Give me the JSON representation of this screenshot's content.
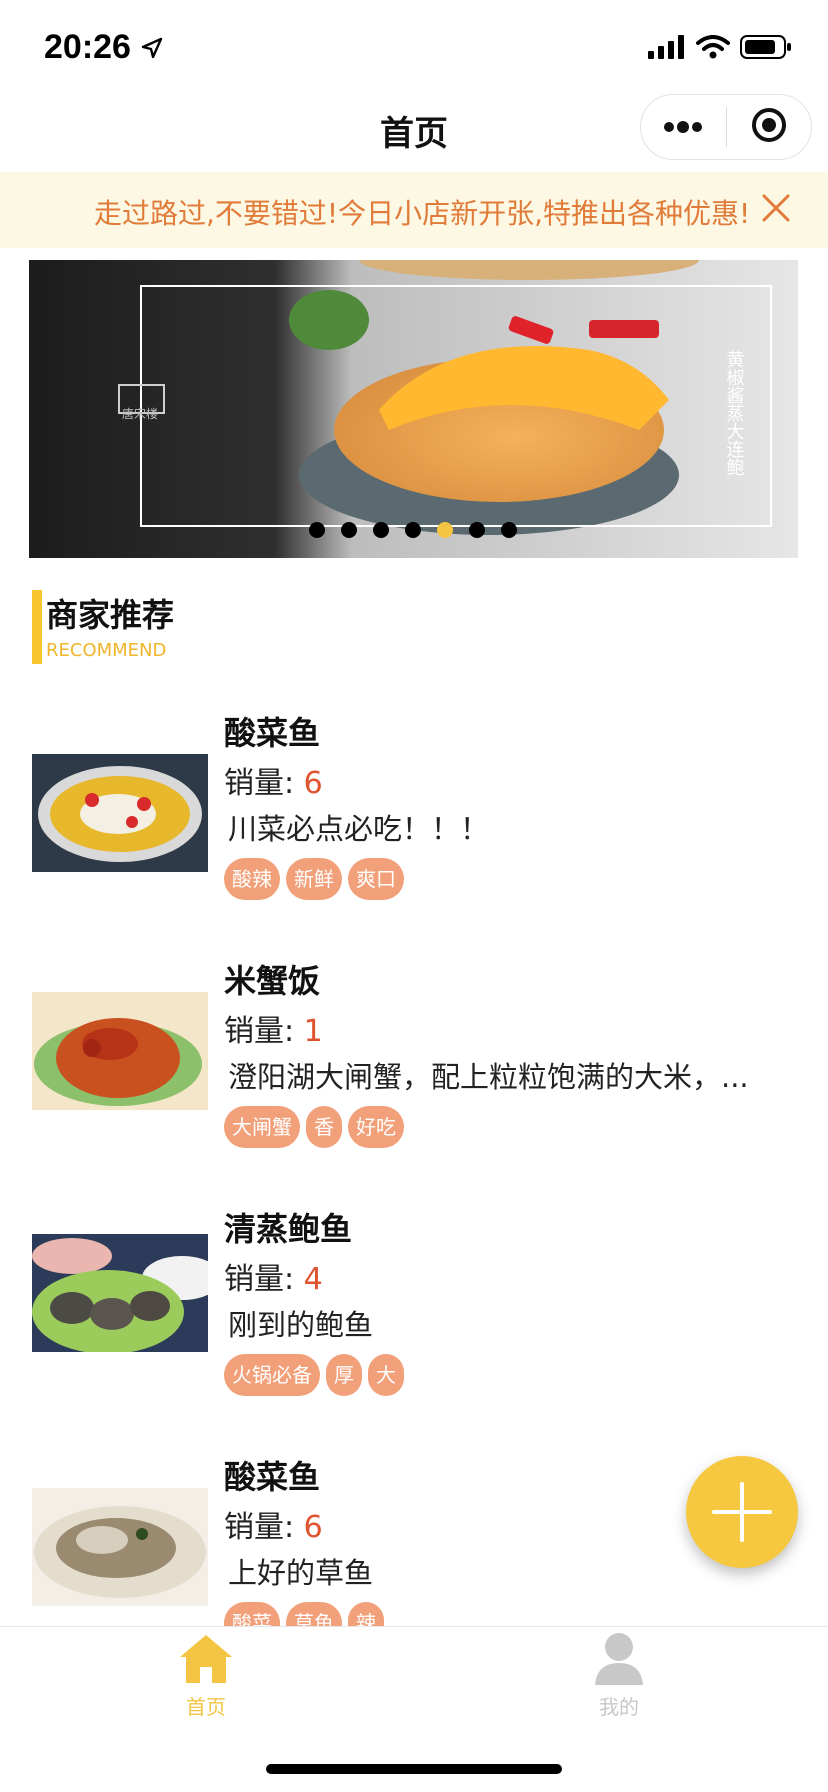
{
  "status_bar": {
    "time": "20:26",
    "icons": [
      "location-arrow-icon",
      "signal-icon",
      "wifi-icon",
      "battery-icon"
    ]
  },
  "nav": {
    "title": "首页",
    "capsule": [
      "more-icon",
      "close-miniprogram-icon"
    ]
  },
  "notice": {
    "text": "走过路过,不要错过!今日小店新开张,特推出各种优惠!",
    "close_icon": "close-icon"
  },
  "banner": {
    "slide_count": 7,
    "active_index": 4,
    "vertical_caption": "黄椒酱蒸大连鲍",
    "logo_caption": "唐宋楼"
  },
  "section": {
    "title": "商家推荐",
    "subtitle": "RECOMMEND"
  },
  "dishes": [
    {
      "name": "酸菜鱼",
      "sales_label": "销量: ",
      "sales": "6",
      "desc": "川菜必点必吃！！！",
      "tags": [
        "酸辣",
        "新鲜",
        "爽口"
      ]
    },
    {
      "name": "米蟹饭",
      "sales_label": "销量: ",
      "sales": "1",
      "desc": "澄阳湖大闸蟹，配上粒粒饱满的大米，...",
      "tags": [
        "大闸蟹",
        "香",
        "好吃"
      ]
    },
    {
      "name": "清蒸鲍鱼",
      "sales_label": "销量: ",
      "sales": "4",
      "desc": "刚到的鲍鱼",
      "tags": [
        "火锅必备",
        "厚",
        "大"
      ]
    },
    {
      "name": "酸菜鱼",
      "sales_label": "销量: ",
      "sales": "6",
      "desc": "上好的草鱼",
      "tags": [
        "酸菜",
        "草鱼",
        "辣"
      ]
    }
  ],
  "fab": {
    "icon": "plus-icon"
  },
  "tab_bar": {
    "items": [
      {
        "label": "首页",
        "icon": "home-icon",
        "active": true
      },
      {
        "label": "我的",
        "icon": "user-icon",
        "active": false
      }
    ],
    "active_color": "#f3c542",
    "inactive_color": "#c8c8c8"
  },
  "colors": {
    "accent": "#f5c83f",
    "notice_text": "#e07b39",
    "notice_bg": "#fdf8e3",
    "tag_bg": "#f2a07a",
    "sales_number": "#e0532f"
  }
}
